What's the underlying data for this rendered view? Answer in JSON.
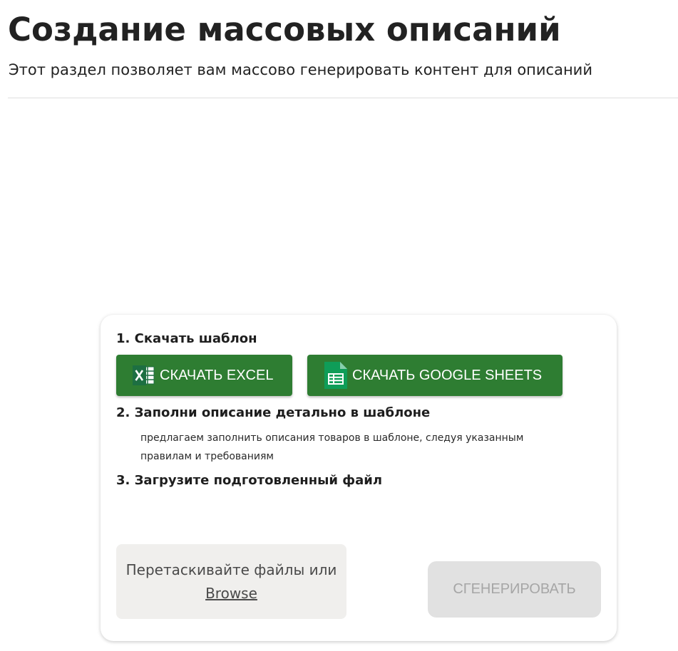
{
  "header": {
    "title": "Создание массовых описаний",
    "subtitle": "Этот раздел позволяет вам массово генерировать контент для описаний"
  },
  "steps": {
    "download": {
      "title": "1. Скачать шаблон",
      "excel_button_label": "СКАЧАТЬ EXCEL",
      "excel_icon": "excel-icon",
      "gsheets_button_label": "СКАЧАТЬ GOOGLE SHEETS",
      "gsheets_icon": "google-sheets-icon"
    },
    "fill": {
      "title": "2. Заполни описание детально в шаблоне",
      "description": "предлагаем заполнить описания товаров в шаблоне, следуя указанным правилам и требованиям"
    },
    "upload": {
      "title": "3. Загрузите подготовленный файл",
      "dropzone_text": "Перетаскивайте файлы или",
      "browse_label": "Browse"
    }
  },
  "actions": {
    "generate_label": "СГЕНЕРИРОВАТЬ",
    "generate_enabled": false
  },
  "colors": {
    "primary_button": "#2e7d32",
    "disabled_button": "#e1e1e1",
    "disabled_text": "#a6a6a6",
    "dropzone_bg": "#f0efed",
    "excel_green": "#1d6f42",
    "sheets_green": "#0f9d58"
  }
}
